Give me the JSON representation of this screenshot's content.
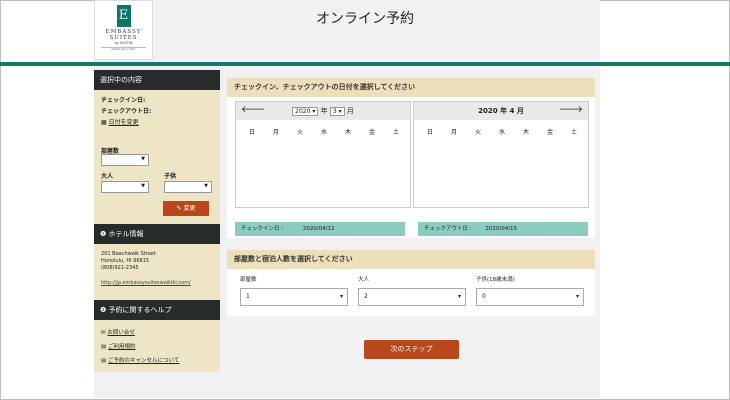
{
  "header": {
    "logo": {
      "name": "EMBASSY SUITES",
      "by": "by HILTON",
      "location": "Waikiki Beach Walk",
      "letter": "E"
    },
    "title": "オンライン予約"
  },
  "sidebar": {
    "selection_header": "選択中の内容",
    "checkin_label": "チェックイン日:",
    "checkout_label": "チェックアウト日:",
    "change_dates_link": "日付を変更",
    "rooms_label": "部屋数",
    "adults_label": "大人",
    "children_label": "子供",
    "change_button": "変更",
    "hotel_header": "ホテル情報",
    "address_line1": "201 Beachwalk Street",
    "address_line2": "Honolulu, HI 96815",
    "phone": "(808)921-2345",
    "website": "http://jp.embassysuiteswaikiki.com/",
    "help_header": "予約に関するヘルプ",
    "help_links": [
      "お問い合せ",
      "ご利用規約",
      "ご予約のキャンセルについて"
    ]
  },
  "main": {
    "date_header": "チェックイン、チェックアウトの日付を選択してください",
    "calendar_left": {
      "year": "2020",
      "year_suffix": "年",
      "month": "3",
      "month_suffix": "月"
    },
    "calendar_right": {
      "title": "2020 年  4 月"
    },
    "weekdays": [
      "日",
      "月",
      "火",
      "水",
      "木",
      "金",
      "土"
    ],
    "checkin": {
      "label": "チェックイン日 :",
      "value": "2020/04/12"
    },
    "checkout": {
      "label": "チェックアウト日 :",
      "value": "2020/04/15"
    },
    "rooms_header": "部屋数と宿泊人数を選択してください",
    "rooms_label": "部屋数",
    "rooms_value": "1",
    "adults_label": "大人",
    "adults_value": "2",
    "children_label": "子供(18歳未満)",
    "children_value": "0",
    "next_button": "次のステップ"
  },
  "chart_data": null
}
